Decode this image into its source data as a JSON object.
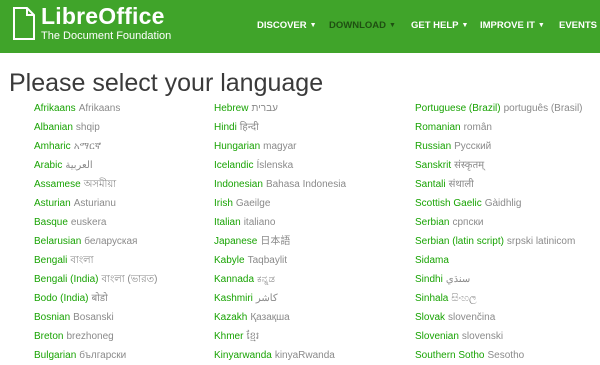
{
  "brand": {
    "name": "LibreOffice",
    "subtitle": "The Document Foundation",
    "color": "#40a42a"
  },
  "nav": [
    {
      "label": "DISCOVER",
      "caret": true,
      "active": false
    },
    {
      "label": "DOWNLOAD",
      "caret": true,
      "active": true
    },
    {
      "label": "GET HELP",
      "caret": true,
      "active": false
    },
    {
      "label": "IMPROVE IT",
      "caret": true,
      "active": false
    },
    {
      "label": "EVENTS",
      "caret": false,
      "active": false
    }
  ],
  "title": "Please select your language",
  "columns": [
    [
      {
        "en": "Afrikaans",
        "native": "Afrikaans"
      },
      {
        "en": "Albanian",
        "native": "shqip"
      },
      {
        "en": "Amharic",
        "native": "አማርኛ"
      },
      {
        "en": "Arabic",
        "native": "العربية"
      },
      {
        "en": "Assamese",
        "native": "অসমীয়া"
      },
      {
        "en": "Asturian",
        "native": "Asturianu"
      },
      {
        "en": "Basque",
        "native": "euskera"
      },
      {
        "en": "Belarusian",
        "native": "беларуская"
      },
      {
        "en": "Bengali",
        "native": "বাংলা"
      },
      {
        "en": "Bengali (India)",
        "native": "বাংলা (ভারত)"
      },
      {
        "en": "Bodo (India)",
        "native": "बोडो"
      },
      {
        "en": "Bosnian",
        "native": "Bosanski"
      },
      {
        "en": "Breton",
        "native": "brezhoneg"
      },
      {
        "en": "Bulgarian",
        "native": "български"
      }
    ],
    [
      {
        "en": "Hebrew",
        "native": "עברית"
      },
      {
        "en": "Hindi",
        "native": "हिन्दी"
      },
      {
        "en": "Hungarian",
        "native": "magyar"
      },
      {
        "en": "Icelandic",
        "native": "Íslenska"
      },
      {
        "en": "Indonesian",
        "native": "Bahasa Indonesia"
      },
      {
        "en": "Irish",
        "native": "Gaeilge"
      },
      {
        "en": "Italian",
        "native": "italiano"
      },
      {
        "en": "Japanese",
        "native": "日本語"
      },
      {
        "en": "Kabyle",
        "native": "Taqbaylit"
      },
      {
        "en": "Kannada",
        "native": "ಕನ್ನಡ"
      },
      {
        "en": "Kashmiri",
        "native": "ﻛﺎﺷﺮ"
      },
      {
        "en": "Kazakh",
        "native": "Қазақша"
      },
      {
        "en": "Khmer",
        "native": "ខ្មែរ"
      },
      {
        "en": "Kinyarwanda",
        "native": "kinyaRwanda"
      }
    ],
    [
      {
        "en": "Portuguese (Brazil)",
        "native": "português (Brasil)"
      },
      {
        "en": "Romanian",
        "native": "român"
      },
      {
        "en": "Russian",
        "native": "Русский"
      },
      {
        "en": "Sanskrit",
        "native": "संस्कृतम्"
      },
      {
        "en": "Santali",
        "native": "संथाली"
      },
      {
        "en": "Scottish Gaelic",
        "native": "Gàidhlig"
      },
      {
        "en": "Serbian",
        "native": "српски"
      },
      {
        "en": "Serbian (latin script)",
        "native": "srpski latinicom"
      },
      {
        "en": "Sidama",
        "native": ""
      },
      {
        "en": "Sindhi",
        "native": "سنڌي"
      },
      {
        "en": "Sinhala",
        "native": "සිංහල"
      },
      {
        "en": "Slovak",
        "native": "slovenčina"
      },
      {
        "en": "Slovenian",
        "native": "slovenski"
      },
      {
        "en": "Southern Sotho",
        "native": "Sesotho"
      }
    ]
  ]
}
